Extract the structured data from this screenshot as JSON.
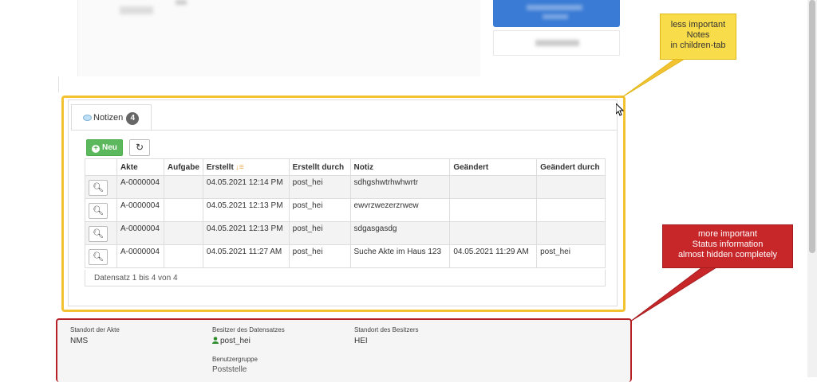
{
  "notes_tab": {
    "label": "Notizen",
    "count": "4"
  },
  "toolbar": {
    "new_label": "Neu",
    "refresh_icon": "refresh-icon"
  },
  "table": {
    "headers": [
      "",
      "Akte",
      "Aufgabe",
      "Erstellt",
      "Erstellt durch",
      "Notiz",
      "Geändert",
      "Geändert durch"
    ],
    "rows": [
      {
        "akte": "A-0000004",
        "aufgabe": "",
        "erstellt": "04.05.2021 12:14 PM",
        "erstellt_durch": "post_hei",
        "notiz": "sdhgshwtrhwhwrtr",
        "geaendert": "",
        "geaendert_durch": ""
      },
      {
        "akte": "A-0000004",
        "aufgabe": "",
        "erstellt": "04.05.2021 12:13 PM",
        "erstellt_durch": "post_hei",
        "notiz": "ewvrzwezerzrwew",
        "geaendert": "",
        "geaendert_durch": ""
      },
      {
        "akte": "A-0000004",
        "aufgabe": "",
        "erstellt": "04.05.2021 12:13 PM",
        "erstellt_durch": "post_hei",
        "notiz": "sdgasgasdg",
        "geaendert": "",
        "geaendert_durch": ""
      },
      {
        "akte": "A-0000004",
        "aufgabe": "",
        "erstellt": "04.05.2021 11:27 AM",
        "erstellt_durch": "post_hei",
        "notiz": "Suche Akte im Haus 123",
        "geaendert": "04.05.2021 11:29 AM",
        "geaendert_durch": "post_hei"
      }
    ],
    "footer": "Datensatz 1 bis 4 von 4"
  },
  "status": {
    "standort_akte_label": "Standort der Akte",
    "standort_akte_value": "NMS",
    "besitzer_label": "Besitzer des Datensatzes",
    "besitzer_value": "post_hei",
    "standort_besitzer_label": "Standort des Besitzers",
    "standort_besitzer_value": "HEI",
    "benutzergruppe_label": "Benutzergruppe",
    "benutzergruppe_value": "Poststelle"
  },
  "callouts": {
    "yellow": [
      "less important",
      "Notes",
      "in children-tab"
    ],
    "red": [
      "more important",
      "Status information",
      "almost hidden completely"
    ]
  },
  "colors": {
    "success": "#5cb85c",
    "highlight_yellow": "#f2c233",
    "highlight_red": "#b52124",
    "callout_red": "#c8272a"
  }
}
